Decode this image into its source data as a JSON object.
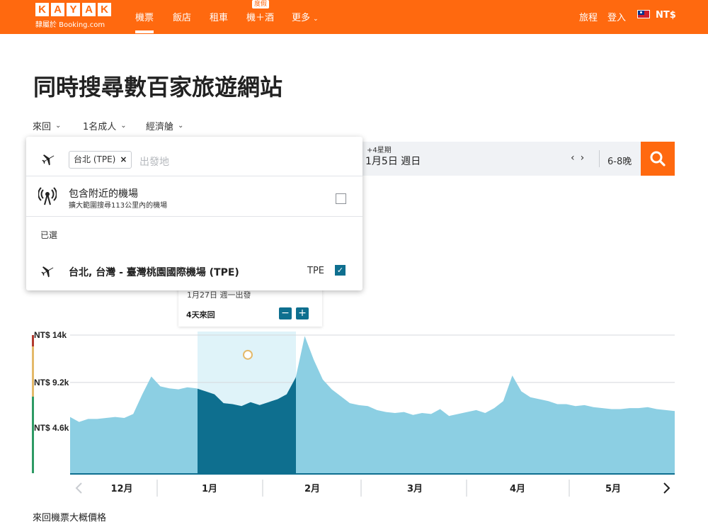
{
  "header": {
    "logo_letters": [
      "K",
      "A",
      "Y",
      "A",
      "K"
    ],
    "logo_sub": "隸屬於 Booking.com",
    "nav": {
      "flights": "機票",
      "hotels": "飯店",
      "cars": "租車",
      "packages": "機＋酒",
      "packages_badge": "度假",
      "more": "更多"
    },
    "trips": "旅程",
    "signin": "登入",
    "currency": "NT$"
  },
  "page_title": "同時搜尋數百家旅遊網站",
  "filters": {
    "trip_type": "來回",
    "travelers": "1名成人",
    "cabin": "經濟艙"
  },
  "search": {
    "origin_chip": "台北 (TPE)",
    "origin_placeholder": "出發地",
    "date_flex": "+4星期",
    "date_value": "1月5日 週日",
    "nights": "6-8晚"
  },
  "dropdown": {
    "nearby_title": "包含附近的機場",
    "nearby_sub": "擴大範圍搜尋113公里內的機場",
    "nearby_checked": false,
    "selected_header": "已選",
    "selected_airport": "台北, 台灣 - 臺灣桃園國際機場 (TPE)",
    "selected_code": "TPE",
    "selected_checked": true
  },
  "trip_popup": {
    "date": "1月27日 週一出發",
    "length": "4天來回"
  },
  "chart_data": {
    "type": "area",
    "y_ticks": [
      "NT$ 14k",
      "NT$ 9.2k",
      "NT$ 4.6k"
    ],
    "ylim": [
      0,
      14000
    ],
    "x_labels": [
      "12月",
      "1月",
      "2月",
      "3月",
      "4月",
      "5月"
    ],
    "series": [
      {
        "values": [
          5700,
          5200,
          5500,
          5500,
          5600,
          5700,
          5600,
          6000,
          8000,
          9800,
          8800,
          8600,
          8500,
          8700,
          8600,
          8300,
          8000,
          7100,
          7000,
          6800,
          7200,
          6900,
          7200,
          7500,
          8000,
          9700,
          13900,
          11500,
          9500,
          8500,
          7800,
          7100,
          6900,
          6800,
          6400,
          6200,
          6100,
          6200,
          5900,
          6100,
          6000,
          6500,
          5800,
          6000,
          6200,
          6400,
          6100,
          6600,
          7300,
          9900,
          8300,
          7700,
          7500,
          7300,
          7000,
          7000,
          6800,
          6900,
          6700,
          6600,
          6500,
          6500,
          6600,
          6600,
          6700,
          6500,
          6400,
          6300
        ]
      }
    ],
    "highlight_range": [
      "1月",
      "2月"
    ],
    "highlight_point": 12000
  },
  "footer_note": "來回機票大概價格",
  "colors": {
    "brand": "#ff690f",
    "chart_area": "#8ccfe3",
    "chart_selected": "#0e6f8f",
    "chart_highlight_bg": "#dff3f9",
    "checkbox": "#0e6f8f"
  }
}
